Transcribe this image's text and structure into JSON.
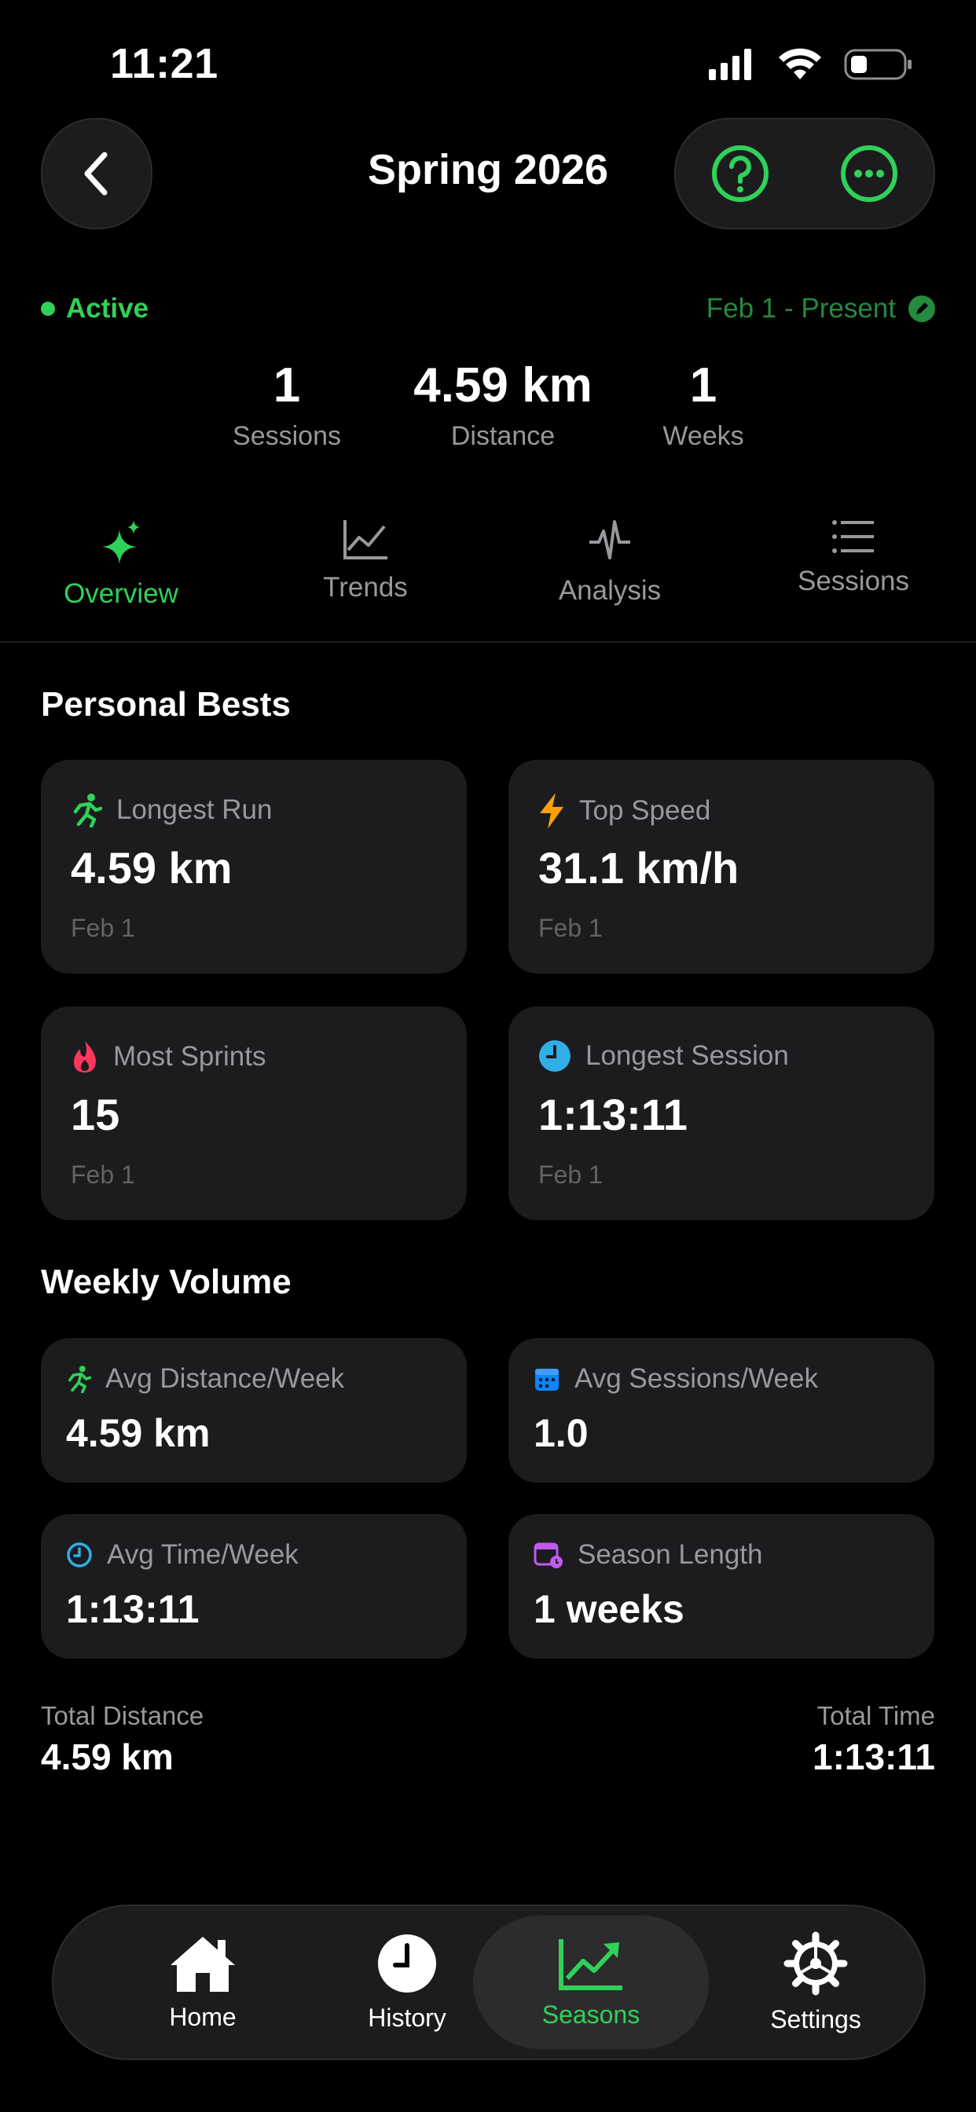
{
  "status_bar": {
    "time": "11:21"
  },
  "header": {
    "title": "Spring 2026"
  },
  "season": {
    "status": "Active",
    "date_range": "Feb 1 - Present",
    "stats": [
      {
        "value": "1",
        "label": "Sessions"
      },
      {
        "value": "4.59 km",
        "label": "Distance"
      },
      {
        "value": "1",
        "label": "Weeks"
      }
    ]
  },
  "tabs": [
    {
      "label": "Overview",
      "icon": "sparkles-icon",
      "selected": true
    },
    {
      "label": "Trends",
      "icon": "line-chart-icon",
      "selected": false
    },
    {
      "label": "Analysis",
      "icon": "waveform-icon",
      "selected": false
    },
    {
      "label": "Sessions",
      "icon": "list-icon",
      "selected": false
    }
  ],
  "personal_bests": {
    "title": "Personal Bests",
    "cards": [
      {
        "label": "Longest Run",
        "value": "4.59 km",
        "date": "Feb 1",
        "icon": "runner-icon",
        "color": "#30d158"
      },
      {
        "label": "Top Speed",
        "value": "31.1 km/h",
        "date": "Feb 1",
        "icon": "bolt-icon",
        "color": "#ff9f0a"
      },
      {
        "label": "Most Sprints",
        "value": "15",
        "date": "Feb 1",
        "icon": "flame-icon",
        "color": "#ff375f"
      },
      {
        "label": "Longest Session",
        "value": "1:13:11",
        "date": "Feb 1",
        "icon": "clock-icon",
        "color": "#32ade6"
      }
    ]
  },
  "weekly_volume": {
    "title": "Weekly Volume",
    "cards": [
      {
        "label": "Avg Distance/Week",
        "value": "4.59 km",
        "icon": "runner-icon",
        "color": "#30d158"
      },
      {
        "label": "Avg Sessions/Week",
        "value": "1.0",
        "icon": "calendar-icon",
        "color": "#0a84ff"
      },
      {
        "label": "Avg Time/Week",
        "value": "1:13:11",
        "icon": "clock-icon",
        "color": "#32ade6"
      },
      {
        "label": "Season Length",
        "value": "1 weeks",
        "icon": "calendar-clock-icon",
        "color": "#bf5af2"
      }
    ]
  },
  "totals": {
    "distance_label": "Total Distance",
    "distance_value": "4.59 km",
    "time_label": "Total Time",
    "time_value": "1:13:11"
  },
  "tab_bar": [
    {
      "label": "Home",
      "icon": "house-icon",
      "selected": false
    },
    {
      "label": "History",
      "icon": "clock-icon",
      "selected": false
    },
    {
      "label": "Seasons",
      "icon": "chart-up-icon",
      "selected": true
    },
    {
      "label": "Settings",
      "icon": "gear-icon",
      "selected": false
    }
  ],
  "colors": {
    "accent": "#30d158",
    "background": "#000000",
    "card": "#1c1c1e"
  }
}
